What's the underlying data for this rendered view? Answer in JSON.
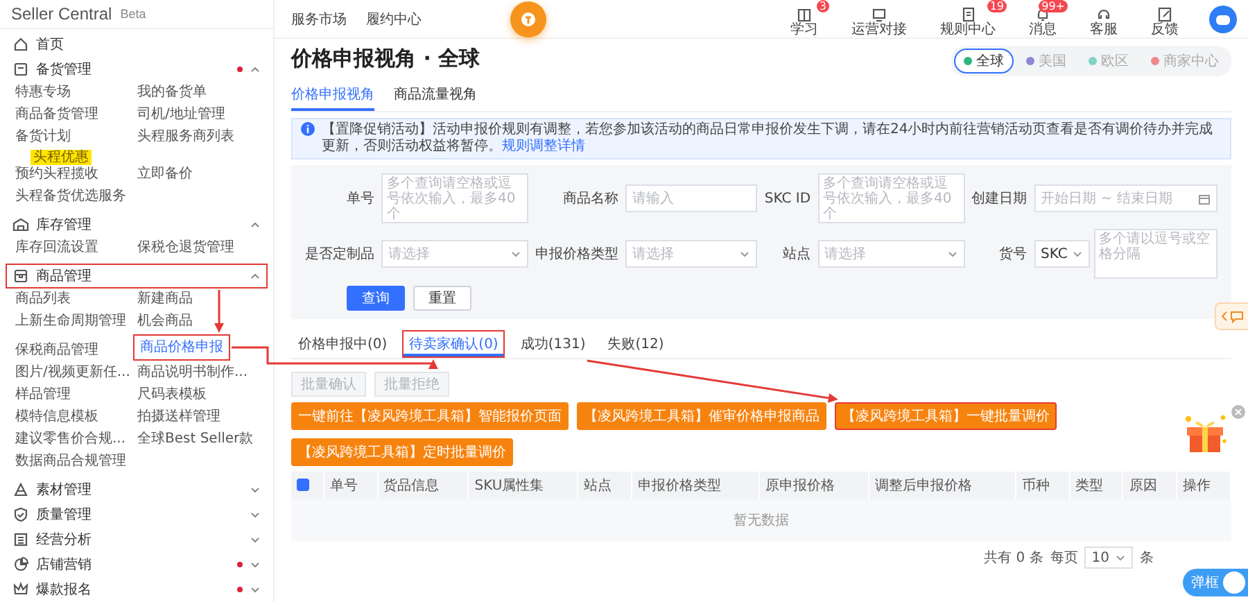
{
  "logo": {
    "name": "Seller Central",
    "badge": "Beta"
  },
  "sidebar": {
    "items": [
      {
        "kind": "link",
        "label": "首页"
      },
      {
        "kind": "group",
        "label": "备货管理",
        "expanded": true,
        "alert": true,
        "highlighted": false,
        "children": [
          {
            "label": "特惠专场",
            "selected": false,
            "highlighted": false
          },
          {
            "label": "我的备货单",
            "selected": false,
            "highlighted": false
          },
          {
            "label": "商品备货管理",
            "selected": false,
            "highlighted": false
          },
          {
            "label": "司机/地址管理",
            "selected": false,
            "highlighted": false
          },
          {
            "label": "备货计划",
            "selected": false,
            "highlighted": false
          },
          {
            "label": "头程服务商列表",
            "selected": false,
            "highlighted": false
          },
          {
            "label": "预约头程揽收",
            "badge": "头程优惠",
            "selected": false,
            "highlighted": false
          },
          {
            "label": "立即备价",
            "selected": false,
            "highlighted": false
          },
          {
            "label": "头程备货优选服务",
            "selected": false,
            "highlighted": false
          }
        ]
      },
      {
        "kind": "group",
        "label": "库存管理",
        "expanded": true,
        "alert": false,
        "highlighted": false,
        "children": [
          {
            "label": "库存回流设置",
            "selected": false,
            "highlighted": false
          },
          {
            "label": "保税仓退货管理",
            "selected": false,
            "highlighted": false
          }
        ]
      },
      {
        "kind": "group",
        "label": "商品管理",
        "expanded": true,
        "alert": false,
        "highlighted": true,
        "children": [
          {
            "label": "商品列表",
            "selected": false,
            "highlighted": false
          },
          {
            "label": "新建商品",
            "selected": false,
            "highlighted": false
          },
          {
            "label": "上新生命周期管理",
            "selected": false,
            "highlighted": false
          },
          {
            "label": "机会商品",
            "selected": false,
            "highlighted": false
          },
          {
            "label": "保税商品管理",
            "selected": false,
            "highlighted": false
          },
          {
            "label": "商品价格申报",
            "selected": true,
            "highlighted": true
          },
          {
            "label": "图片/视频更新任...",
            "selected": false,
            "highlighted": false
          },
          {
            "label": "商品说明书制作...",
            "selected": false,
            "highlighted": false
          },
          {
            "label": "样品管理",
            "selected": false,
            "highlighted": false
          },
          {
            "label": "尺码表模板",
            "selected": false,
            "highlighted": false
          },
          {
            "label": "模特信息模板",
            "selected": false,
            "highlighted": false
          },
          {
            "label": "拍摄送样管理",
            "selected": false,
            "highlighted": false
          },
          {
            "label": "建议零售价合规...",
            "selected": false,
            "highlighted": false
          },
          {
            "label": "全球Best Seller款",
            "selected": false,
            "highlighted": false
          },
          {
            "label": "数据商品合规管理",
            "selected": false,
            "highlighted": false
          }
        ]
      },
      {
        "kind": "group",
        "label": "素材管理",
        "expanded": false,
        "alert": false,
        "highlighted": false
      },
      {
        "kind": "group",
        "label": "质量管理",
        "expanded": false,
        "alert": false,
        "highlighted": false
      },
      {
        "kind": "group",
        "label": "经营分析",
        "expanded": false,
        "alert": false,
        "highlighted": false
      },
      {
        "kind": "group",
        "label": "店铺营销",
        "expanded": false,
        "alert": true,
        "highlighted": false
      },
      {
        "kind": "group",
        "label": "爆款报名",
        "expanded": false,
        "alert": true,
        "highlighted": false
      }
    ]
  },
  "topbar": {
    "links": [
      "服务市场",
      "履约中心"
    ],
    "tools": [
      {
        "label": "学习",
        "badge": "3"
      },
      {
        "label": "运营对接"
      },
      {
        "label": "规则中心",
        "badge": "19"
      },
      {
        "label": "消息",
        "badge": "99+"
      },
      {
        "label": "客服"
      },
      {
        "label": "反馈"
      }
    ]
  },
  "page": {
    "title": "价格申报视角 · 全球",
    "view_tabs": [
      {
        "label": "价格申报视角",
        "selected": true
      },
      {
        "label": "商品流量视角",
        "selected": false
      }
    ],
    "sites": [
      {
        "label": "全球",
        "color": "#2fb47c",
        "selected": true
      },
      {
        "label": "美国",
        "color": "#8f86d6",
        "selected": false
      },
      {
        "label": "欧区",
        "color": "#7fd3c8",
        "selected": false
      },
      {
        "label": "商家中心",
        "color": "#ef8a8a",
        "selected": false
      }
    ]
  },
  "notice": {
    "text": "【置降促销活动】活动申报价规则有调整，若您参加该活动的商品日常申报价发生下调，请在24小时内前往营销活动页查看是否有调价待办并完成更新，否则活动权益将暂停。",
    "link": "规则调整详情"
  },
  "filters": [
    {
      "label": "单号",
      "kind": "text",
      "placeholder": "多个查询请空格或逗号依次输入，最多40个"
    },
    {
      "label": "商品名称",
      "kind": "text",
      "placeholder": "请输入"
    },
    {
      "label": "SKC ID",
      "kind": "text",
      "placeholder": "多个查询请空格或逗号依次输入，最多40个"
    },
    {
      "label": "创建日期",
      "kind": "date",
      "placeholder": "开始日期 ~ 结束日期"
    },
    {
      "label": "是否定制品",
      "kind": "select",
      "placeholder": "请选择"
    },
    {
      "label": "申报价格类型",
      "kind": "select",
      "placeholder": "请选择"
    },
    {
      "label": "站点",
      "kind": "select",
      "placeholder": "请选择"
    },
    {
      "label": "货号",
      "kind": "combo",
      "value": "SKC",
      "placeholder": "多个请以逗号或空格分隔"
    }
  ],
  "filter_actions": [
    {
      "label": "查询",
      "kind": "primary"
    },
    {
      "label": "重置",
      "kind": "default"
    }
  ],
  "status_tabs": [
    {
      "label": "价格申报中(0)",
      "selected": false,
      "highlighted": false
    },
    {
      "label": "待卖家确认(0)",
      "selected": true,
      "highlighted": true
    },
    {
      "label": "成功(131)",
      "selected": false,
      "highlighted": false
    },
    {
      "label": "失败(12)",
      "selected": false,
      "highlighted": false
    }
  ],
  "batch_buttons": [
    {
      "label": "批量确认",
      "disabled": true
    },
    {
      "label": "批量拒绝",
      "disabled": true
    }
  ],
  "tool_buttons": [
    {
      "label": "一键前往【凌风跨境工具箱】智能报价页面",
      "highlighted": false
    },
    {
      "label": "【凌风跨境工具箱】催审价格申报商品",
      "highlighted": false
    },
    {
      "label": "【凌风跨境工具箱】一键批量调价",
      "highlighted": true
    },
    {
      "label": "【凌风跨境工具箱】定时批量调价",
      "highlighted": false
    }
  ],
  "table": {
    "select_all": true,
    "columns": [
      "单号",
      "货品信息",
      "SKU属性集",
      "站点",
      "申报价格类型",
      "原申报价格",
      "调整后申报价格",
      "币种",
      "类型",
      "原因",
      "操作"
    ],
    "empty": "暂无数据"
  },
  "pagination": {
    "total": "共有 0 条",
    "per_page_label": "每页",
    "per_page": "10",
    "unit": "条"
  },
  "toggle": {
    "label": "弹框",
    "on": true
  },
  "annotation": {
    "arrows": true
  }
}
